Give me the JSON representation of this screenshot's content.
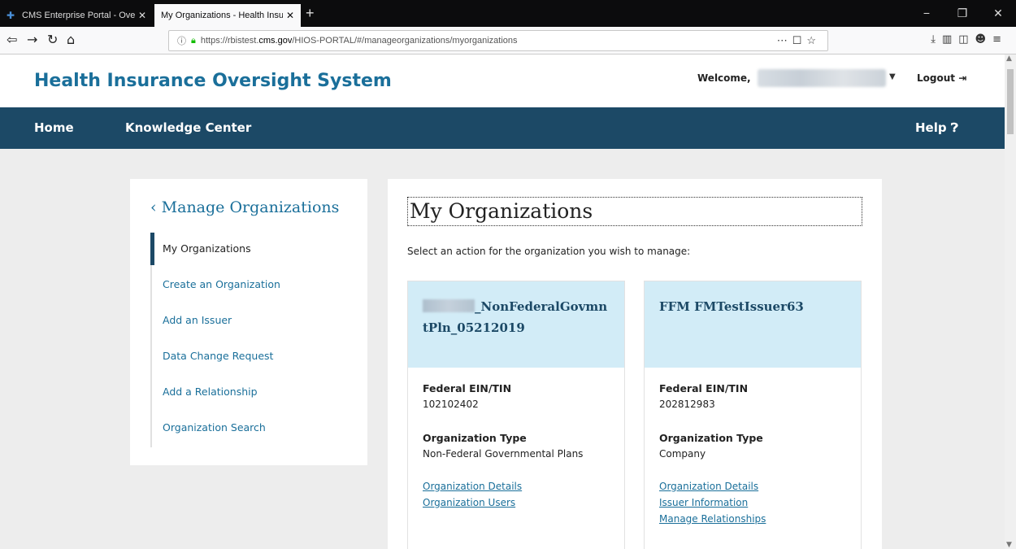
{
  "browser": {
    "tabs": [
      {
        "title": "CMS Enterprise Portal - Overvie",
        "close": "✕"
      },
      {
        "title": "My Organizations - Health Insuranc",
        "close": "✕"
      }
    ],
    "new_tab": "+",
    "window_controls": [
      "−",
      "❐",
      "✕"
    ],
    "url": {
      "prefix": "https://rbistest.",
      "host": "cms.gov",
      "path": "/HIOS-PORTAL/#/manageorganizations/myorganizations"
    }
  },
  "header": {
    "title": "Health Insurance Oversight System",
    "welcome": "Welcome,",
    "logout": "Logout"
  },
  "nav": {
    "items": [
      "Home",
      "Knowledge Center"
    ],
    "help": "Help"
  },
  "sidebar": {
    "heading": "Manage Organizations",
    "items": [
      {
        "label": "My Organizations",
        "active": true
      },
      {
        "label": "Create an Organization"
      },
      {
        "label": "Add an Issuer"
      },
      {
        "label": "Data Change Request"
      },
      {
        "label": "Add a Relationship"
      },
      {
        "label": "Organization Search"
      }
    ]
  },
  "main": {
    "title": "My Organizations",
    "intro": "Select an action for the organization you wish to manage:",
    "cards": [
      {
        "name_part1": "_NonFederalGovmn",
        "name_part2": "tPln_05212019",
        "ein_label": "Federal EIN/TIN",
        "ein": "102102402",
        "type_label": "Organization Type",
        "type": "Non-Federal Governmental Plans",
        "links": [
          "Organization Details",
          "Organization Users"
        ]
      },
      {
        "name": "FFM FMTestIssuer63",
        "ein_label": "Federal EIN/TIN",
        "ein": "202812983",
        "type_label": "Organization Type",
        "type": "Company",
        "links": [
          "Organization Details",
          "Issuer Information",
          "Manage Relationships"
        ]
      }
    ]
  },
  "colors": {
    "brand": "#1a6f9a",
    "nav_bg": "#1c4966",
    "card_head": "#d2ecf7",
    "page_bg": "#ededed"
  }
}
